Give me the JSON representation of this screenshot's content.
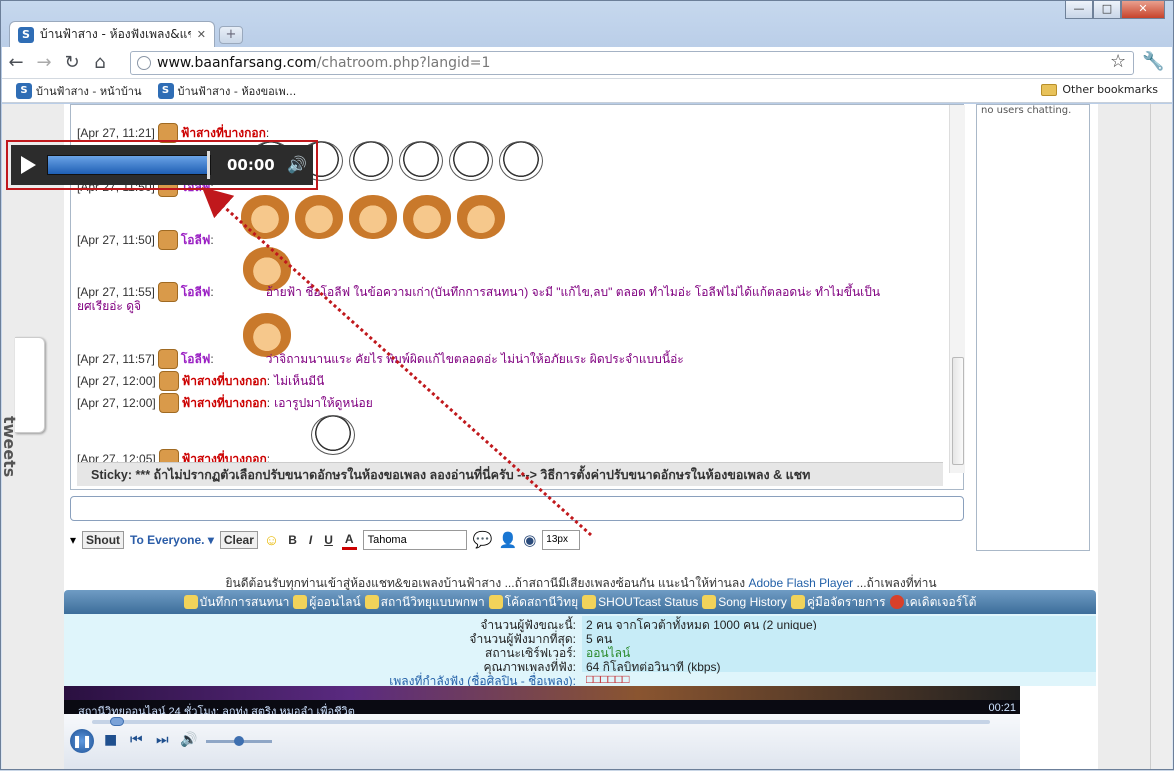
{
  "window": {
    "minimize": "—",
    "maximize": "□",
    "close": "✕"
  },
  "tab": {
    "title": "บ้านฟ้าสาง - ห้องฟังเพลง&แชท",
    "close": "✕",
    "favicon": "S"
  },
  "new_tab": "+",
  "nav": {
    "back": "←",
    "forward": "→",
    "reload": "↻",
    "home": "⌂",
    "url_host": "www.baanfarsang.com",
    "url_path": "/chatroom.php?langid=1",
    "star": "☆",
    "wrench": "🔧"
  },
  "bookmarks": {
    "items": [
      "บ้านฟ้าสาง - หน้าบ้าน",
      "บ้านฟ้าสาง - ห้องขอเพ..."
    ],
    "other": "Other bookmarks"
  },
  "tweets_tab": "tweets",
  "users_panel": {
    "text": "no users chatting."
  },
  "chat": {
    "lines": [
      {
        "time": "[Apr 27, 11:21]",
        "nick": "ฟ้าสางที่บางกอก",
        "sep": " :",
        "msg": ""
      },
      {
        "time": "[Apr 27, 11:50]",
        "nick": "โอลีฟ",
        "sep": " :",
        "msg": ""
      },
      {
        "time": "[Apr 27, 11:50]",
        "nick": "โอลีฟ",
        "sep": " :",
        "msg": ""
      },
      {
        "time": "[Apr 27, 11:55]",
        "nick": "โอลีฟ",
        "sep": " :",
        "msg": "อ้ายฟ้า ชื่อโอลีฟ ในข้อความเก่า(บันทึกการสนทนา) จะมี \"แก้ไข,ลบ\" ตลอด ทำไมอ่ะ โอลีฟไม่ได้แก้ตลอดน่ะ ทำไมขึ้นเป็น",
        "msg2": "ยศเรียอ่ะ ดูจิ"
      },
      {
        "time": "[Apr 27, 11:57]",
        "nick": "โอลีฟ",
        "sep": " :",
        "msg": "ว่าจิถามนานแระ คัยไร พิมพ์ผิดแก้ไขตลอดอ่ะ ไม่น่าให้อภัยแระ ผิดประจำแบบนี้อ่ะ"
      },
      {
        "time": "[Apr 27, 12:00]",
        "nick": "ฟ้าสางที่บางกอก",
        "sep": " :",
        "msg": "ไม่เห็นมีนี"
      },
      {
        "time": "[Apr 27, 12:00]",
        "nick": "ฟ้าสางที่บางกอก",
        "sep": " :",
        "msg": "เอารูปมาให้ดูหน่อย"
      },
      {
        "time": "[Apr 27, 12:05]",
        "nick": "ฟ้าสางที่บางกอก",
        "sep": " :",
        "msg": ""
      }
    ],
    "sticky": "Sticky: *** ถ้าไม่ปรากฏตัวเลือกปรับขนาดอักษรในห้องขอเพลง ลองอ่านที่นี่ครับ ---> วิธีการตั้งค่าปรับขนาดอักษรในห้องขอเพลง & แชท"
  },
  "mini_player": {
    "time": "00:00"
  },
  "chat_tools": {
    "shout": "Shout",
    "to_everyone": "To Everyone.",
    "clear": "Clear",
    "bold": "B",
    "italic": "I",
    "underline": "U",
    "color": "A",
    "font": "Tahoma",
    "size": "13px"
  },
  "welcome": {
    "text": "ยินดีต้อนรับทุกท่านเข้าสู่ห้องแชท&ขอเพลงบ้านฟ้าสาง    ...ถ้าสถานีมีเสียงเพลงซ้อนกัน แนะนำให้ท่านลง",
    "link": "Adobe Flash Player",
    "tail": "   ...ถ้าเพลงที่ท่าน"
  },
  "nav_bar": {
    "items": [
      "บันทึกการสนทนา",
      "ผู้ออนไลน์",
      "สถานีวิทยุแบบพกพา",
      "โค้ดสถานีวิทยุ",
      "SHOUTcast Status",
      "Song History",
      "คู่มือจัดรายการ",
      "เคเดิตเจอร์โต้"
    ]
  },
  "stats": [
    {
      "label": "จำนวนผู้ฟังขณะนี้:",
      "value": "2 คน จากโควต้าทั้งหมด 1000 คน (2 unique)"
    },
    {
      "label": "จำนวนผู้ฟังมากที่สุด:",
      "value": "5 คน"
    },
    {
      "label": "สถานะเซิร์ฟเวอร์:",
      "value": "ออนไลน์"
    },
    {
      "label": "คุณภาพเพลงที่ฟัง:",
      "value": "64 กิโลบิทต่อวินาที (kbps)"
    },
    {
      "label": "เพลงที่กำลังฟัง (ชื่อศิลปิน - ชื่อเพลง):",
      "value": "□□□□□□"
    }
  ],
  "colors": {
    "status_online": "#2a8a2a",
    "now_playing_label": "#2461a8",
    "now_playing_value": "#c0181c"
  },
  "player": {
    "title": "สถานีวิทยุออนไลน์ 24 ชั่วโมง: ลูกทุ่ง สตริง หมอลำ เพื่อชีวิต",
    "time": "00:21",
    "seek_fraction": 0.02,
    "volume_fraction": 0.5
  }
}
